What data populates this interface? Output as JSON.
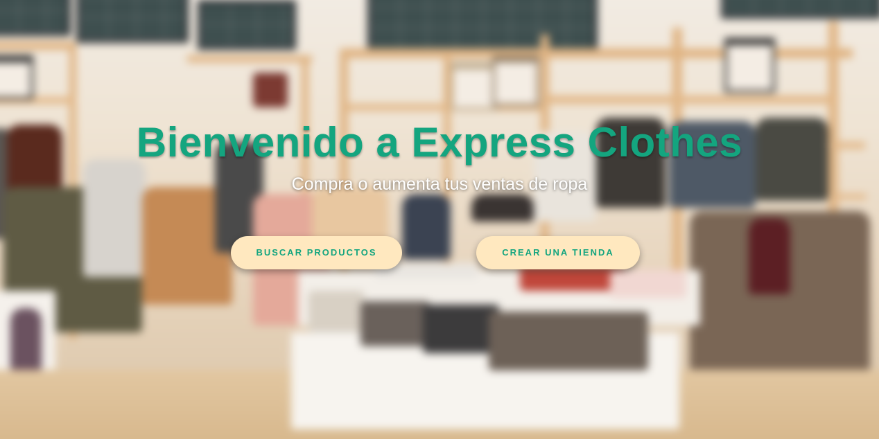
{
  "hero": {
    "title": "Bienvenido a Express Clothes",
    "subtitle": "Compra o aumenta tus ventas de ropa",
    "buttons": {
      "search_products": "BUSCAR PRODUCTOS",
      "create_store": "CREAR UNA TIENDA"
    },
    "background_image": "blurred-clothing-store"
  },
  "colors": {
    "accent": "#14a57f",
    "button_bg": "#ffe8bf",
    "subtitle": "#ffffff"
  }
}
